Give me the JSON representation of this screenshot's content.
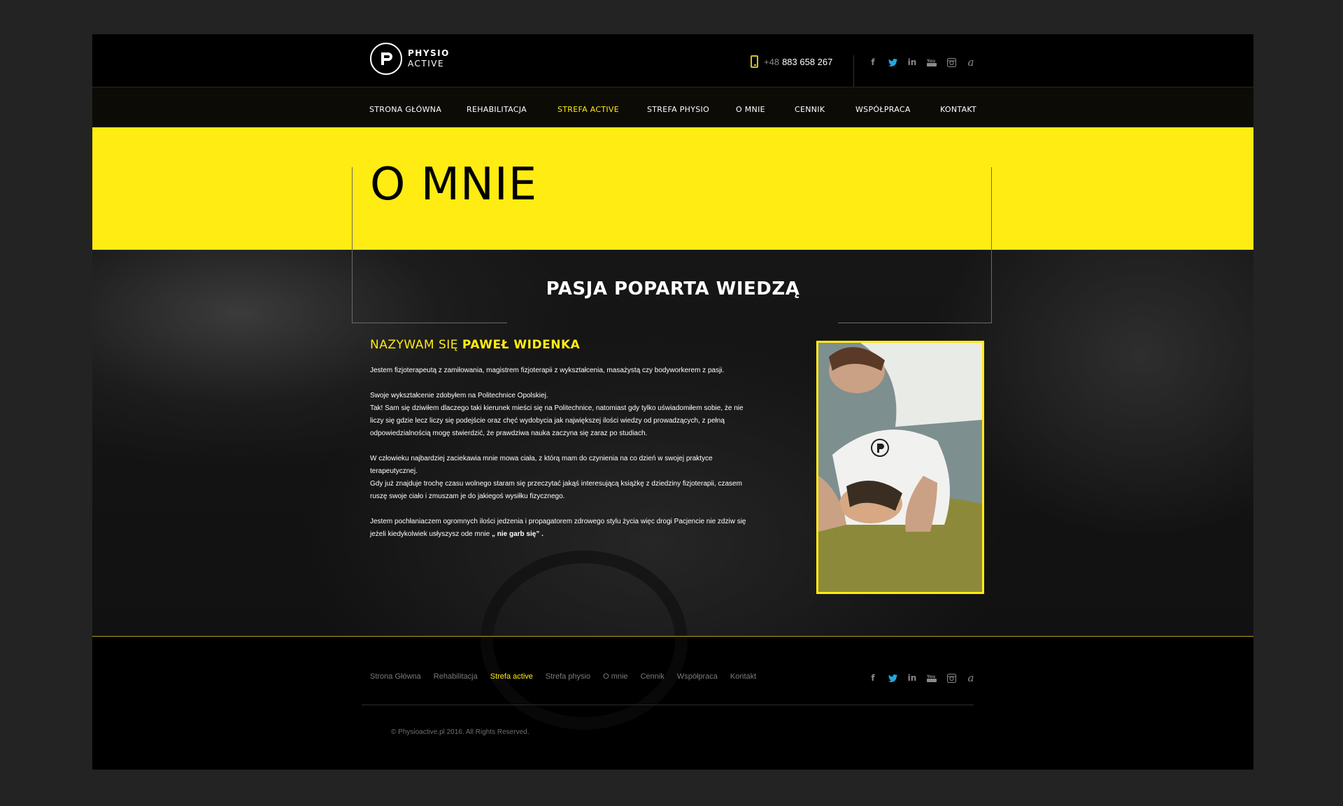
{
  "header": {
    "logo": {
      "line1": "PHYSIO",
      "line2": "ACTIVE"
    },
    "phone": {
      "prefix": "+48",
      "number": "883 658 267",
      "icon": "phone-icon"
    },
    "socials": [
      "facebook-icon",
      "twitter-icon",
      "linkedin-icon",
      "youtube-icon",
      "instagram-icon",
      "a-icon"
    ]
  },
  "nav": {
    "items": [
      {
        "label": "STRONA GŁÓWNA",
        "active": false
      },
      {
        "label": "REHABILITACJA",
        "active": false
      },
      {
        "label": "STREFA ACTIVE",
        "active": true
      },
      {
        "label": "STREFA PHYSIO",
        "active": false
      },
      {
        "label": "O MNIE",
        "active": false
      },
      {
        "label": "CENNIK",
        "active": false
      },
      {
        "label": "WSPÓŁPRACA",
        "active": false
      },
      {
        "label": "KONTAKT",
        "active": false
      }
    ]
  },
  "banner": {
    "title": "O MNIE"
  },
  "content": {
    "subtitle": "PASJA POPARTA WIEDZĄ",
    "name_prefix": "NAZYWAM SIĘ",
    "name": "PAWEŁ WIDENKA",
    "paragraphs": [
      [
        "Jestem fizjoterapeutą z zamiłowania, magistrem fizjoterapii z wykształcenia, masażystą czy bodyworkerem z pasji."
      ],
      [
        "Swoje wykształcenie zdobyłem na Politechnice Opolskiej.",
        "Tak! Sam się dziwiłem dlaczego taki kierunek mieści się na Politechnice, natomiast gdy tylko uświadomiłem sobie, że nie",
        "liczy się gdzie lecz liczy się podejście oraz chęć wydobycia jak największej ilości wiedzy od prowadzących, z pełną",
        "odpowiedzialnością mogę stwierdzić, że prawdziwa nauka zaczyna się zaraz po studiach."
      ],
      [
        "W człowieku najbardziej zaciekawia mnie mowa ciała, z którą mam do czynienia na co dzień w swojej praktyce",
        " terapeutycznej.",
        "Gdy już znajduje trochę czasu wolnego staram się przeczytać jakąś interesującą książkę z dziedziny fizjoterapii, czasem",
        "ruszę swoje ciało i zmuszam je do jakiegoś wysiłku fizycznego."
      ],
      [
        "Jestem pochłaniaczem ogromnych ilości jedzenia i propagatorem zdrowego stylu życia więc drogi Pacjencie nie zdziw się",
        "jeżeli kiedykolwiek usłyszysz ode mnie"
      ]
    ],
    "quote": "„ nie garb się” .",
    "photo_alt": "therapist-photo"
  },
  "footer": {
    "links": [
      {
        "label": "Strona Główna",
        "active": false
      },
      {
        "label": "Rehabilitacja",
        "active": false
      },
      {
        "label": "Strefa active",
        "active": true
      },
      {
        "label": "Strefa physio",
        "active": false
      },
      {
        "label": "O mnie",
        "active": false
      },
      {
        "label": "Cennik",
        "active": false
      },
      {
        "label": "Współpraca",
        "active": false
      },
      {
        "label": "Kontakt",
        "active": false
      }
    ],
    "copyright": "© Physioactive.pl 2016. All Rights Reserved."
  },
  "colors": {
    "accent": "#ffec12",
    "background": "#000000",
    "twitter": "#22a7e0"
  }
}
